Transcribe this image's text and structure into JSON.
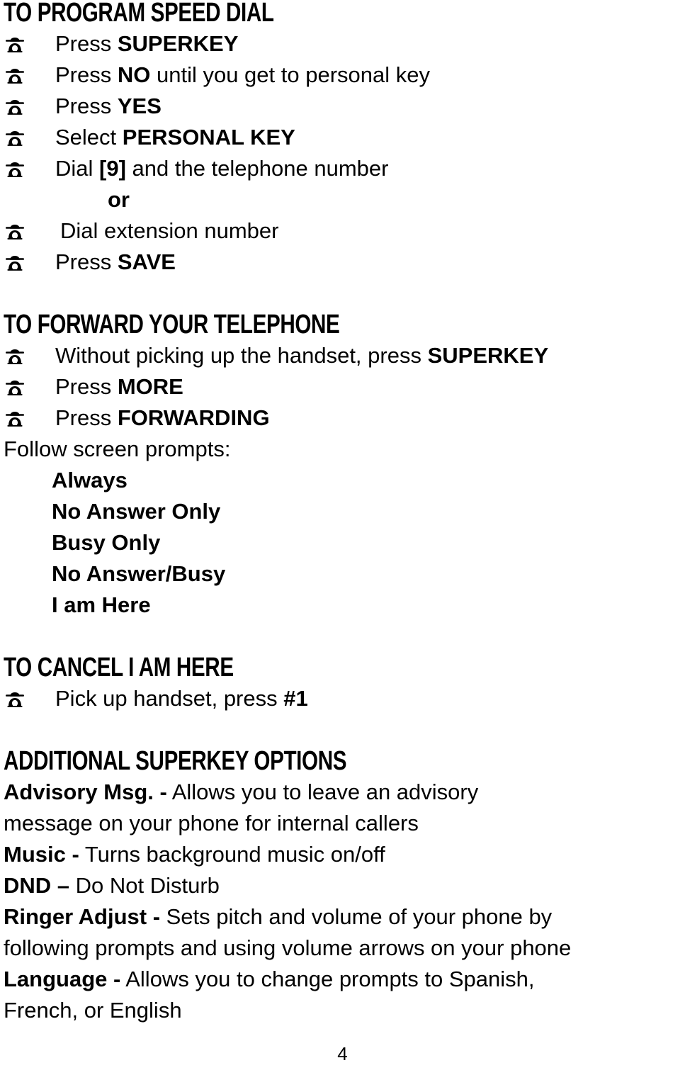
{
  "document": {
    "page_number": "4",
    "bullet_icon": "telephone-icon"
  },
  "sections": [
    {
      "heading": "TO PROGRAM SPEED DIAL",
      "lines": [
        {
          "kind": "bullet",
          "pre": "Press ",
          "bold": "SUPERKEY",
          "post": ""
        },
        {
          "kind": "bullet",
          "pre": "Press ",
          "bold": "NO",
          "post": " until you get to personal key"
        },
        {
          "kind": "bullet",
          "pre": "Press ",
          "bold": "YES",
          "post": ""
        },
        {
          "kind": "bullet",
          "pre": "Select ",
          "bold": "PERSONAL KEY",
          "post": ""
        },
        {
          "kind": "bullet",
          "pre": "Dial ",
          "bold": "[9]",
          "post": " and the telephone number"
        },
        {
          "kind": "or",
          "text": "or"
        },
        {
          "kind": "bullet-indent",
          "pre": " Dial extension number",
          "bold": "",
          "post": ""
        },
        {
          "kind": "bullet",
          "pre": "Press ",
          "bold": "SAVE",
          "post": ""
        }
      ]
    },
    {
      "heading": "TO FORWARD YOUR TELEPHONE",
      "lines": [
        {
          "kind": "bullet",
          "pre": "Without picking up the handset, press ",
          "bold": "SUPERKEY",
          "post": ""
        },
        {
          "kind": "bullet",
          "pre": "Press ",
          "bold": "MORE",
          "post": ""
        },
        {
          "kind": "bullet",
          "pre": "Press ",
          "bold": "FORWARDING",
          "post": ""
        },
        {
          "kind": "plain",
          "text": "Follow screen prompts:"
        },
        {
          "kind": "indent",
          "text": "Always"
        },
        {
          "kind": "indent",
          "text": "No Answer Only"
        },
        {
          "kind": "indent",
          "text": "Busy Only"
        },
        {
          "kind": "indent",
          "text": "No Answer/Busy"
        },
        {
          "kind": "indent",
          "text": "I am Here"
        }
      ]
    },
    {
      "heading": "TO CANCEL I AM HERE",
      "lines": [
        {
          "kind": "bullet",
          "pre": "Pick up handset, press ",
          "bold": "#1",
          "post": ""
        }
      ]
    },
    {
      "heading": "ADDITIONAL SUPERKEY OPTIONS",
      "lines": [
        {
          "kind": "plain-rich",
          "bold": "Advisory Msg. -",
          "post": " Allows you to leave an advisory"
        },
        {
          "kind": "plain",
          "text": "message on your phone for internal callers"
        },
        {
          "kind": "plain-rich",
          "bold": "Music -",
          "post": " Turns background music on/off"
        },
        {
          "kind": "plain-rich",
          "bold": "DND –",
          "post": " Do Not Disturb"
        },
        {
          "kind": "plain-rich",
          "bold": "Ringer Adjust -",
          "post": " Sets pitch and volume of your phone by"
        },
        {
          "kind": "plain",
          "text": "following prompts and using volume arrows on your phone"
        },
        {
          "kind": "plain-rich",
          "bold": "Language -",
          "post": " Allows you to change prompts to Spanish,"
        },
        {
          "kind": "plain",
          "text": "French, or English"
        }
      ]
    }
  ]
}
